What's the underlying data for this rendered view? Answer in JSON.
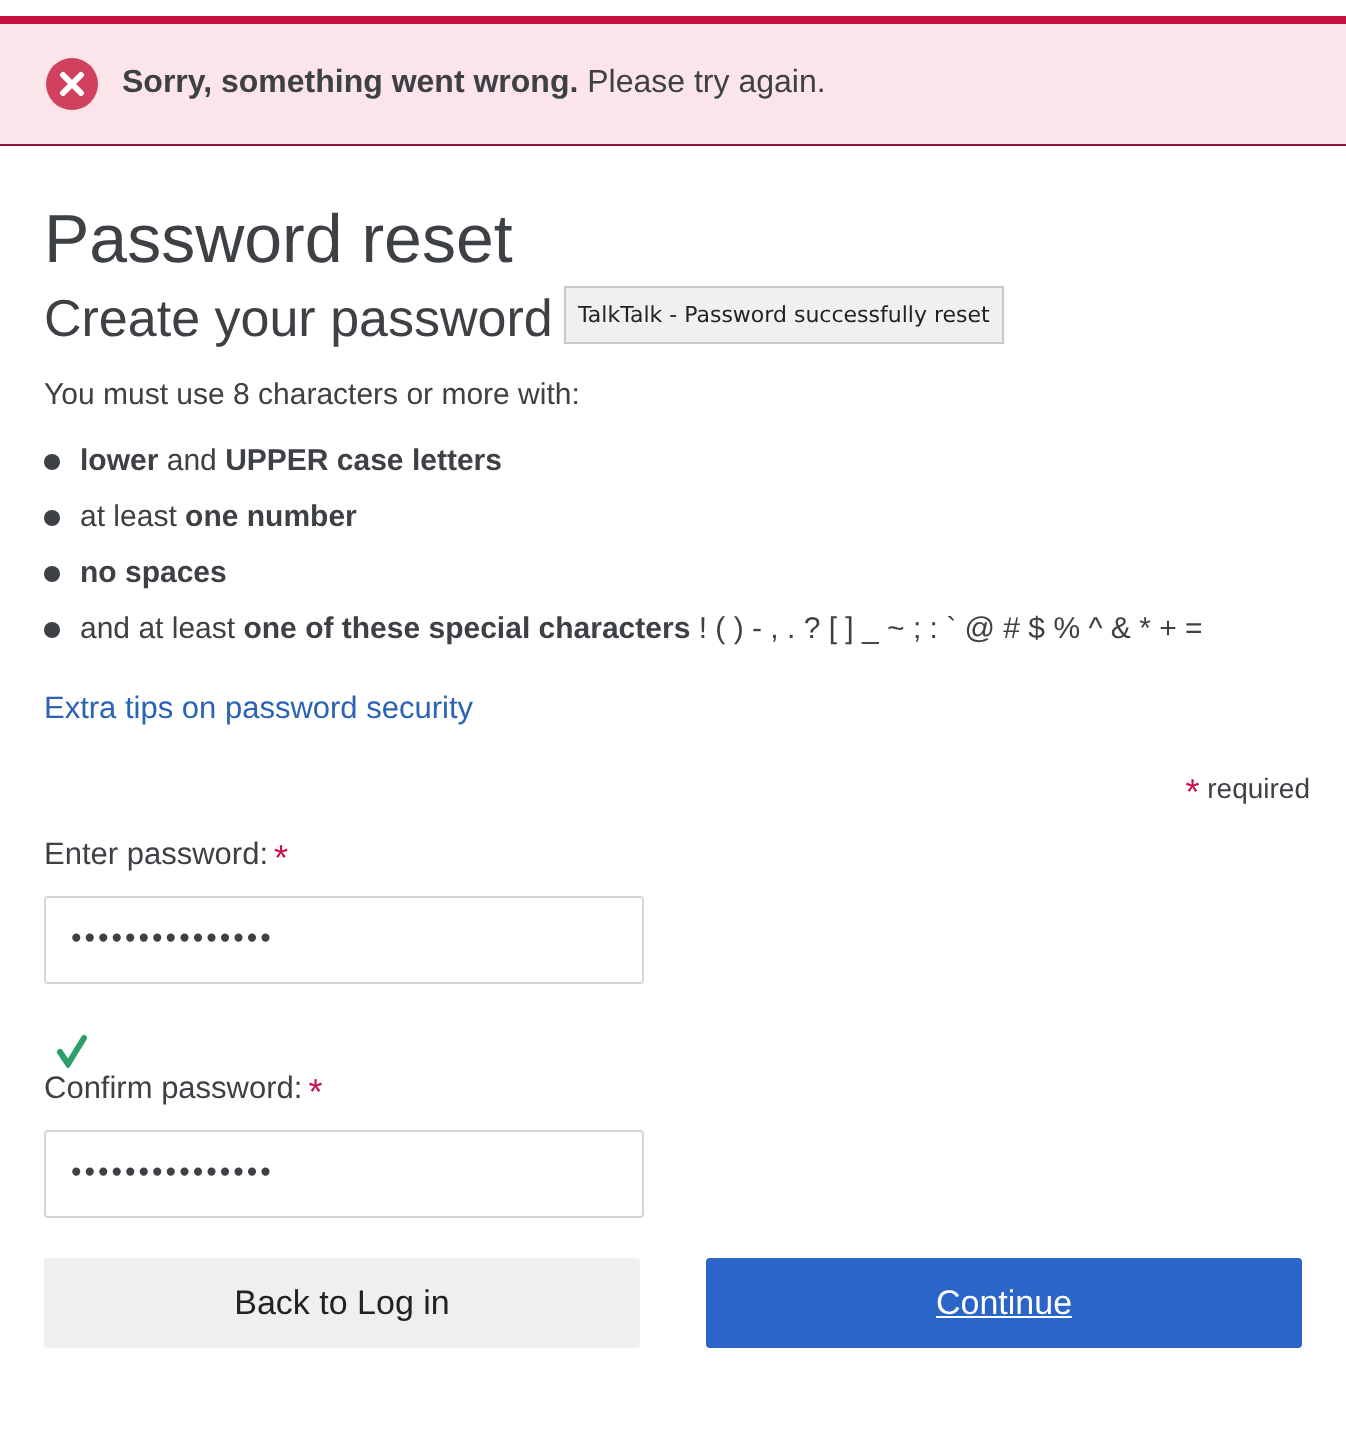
{
  "alert": {
    "kind": "error",
    "message": "**Sorry, something went wrong.** Please try again."
  },
  "title": "Password reset",
  "subtitle": "Create your password",
  "tooltip": "TalkTalk - Password successfully reset",
  "intro": "You must use 8 characters or more with:",
  "rules": [
    {
      "text": "**lower** and **UPPER case letters**"
    },
    {
      "text": "at least **one number**"
    },
    {
      "text": "**no spaces**"
    },
    {
      "text": "and at least **one of these special characters** ! ( ) - , . ? [ ] _ ~ ; : ` @ # $ % ^ & * + ="
    }
  ],
  "tips_link": "Extra tips on password security",
  "required_note": {
    "mark": "*",
    "text": "required"
  },
  "fields": [
    {
      "label": "Enter password:",
      "required": true,
      "value": "•••••••••••••••"
    },
    {
      "label": "Confirm password:",
      "required": true,
      "value": "•••••••••••••••"
    }
  ],
  "passwords_match": true,
  "buttons": [
    {
      "label": "Back to Log in",
      "kind": "secondary"
    },
    {
      "label": "Continue",
      "kind": "primary"
    }
  ]
}
